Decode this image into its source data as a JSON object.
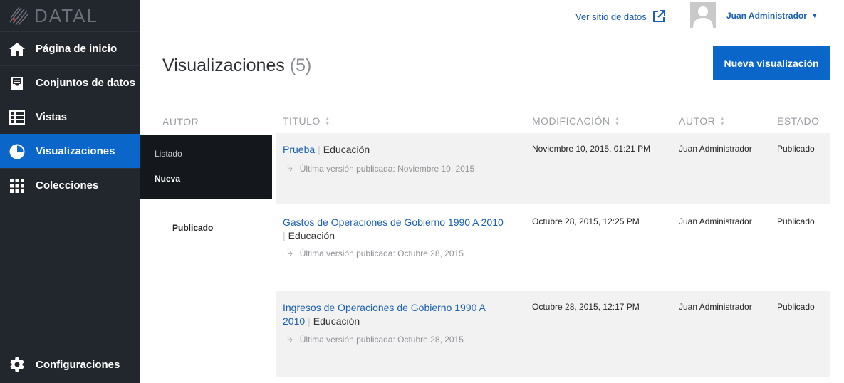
{
  "brand": {
    "name": "DATAL"
  },
  "sidebar": {
    "items": [
      {
        "label": "Página de inicio",
        "icon": "home-icon"
      },
      {
        "label": "Conjuntos de datos",
        "icon": "inbox-icon"
      },
      {
        "label": "Vistas",
        "icon": "table-icon"
      },
      {
        "label": "Visualizaciones",
        "icon": "pie-chart-icon",
        "active": true
      },
      {
        "label": "Colecciones",
        "icon": "grid-icon"
      }
    ],
    "settings": {
      "label": "Configuraciones",
      "icon": "gear-icon"
    },
    "submenu": {
      "listado": "Listado",
      "nueva": "Nueva"
    }
  },
  "header": {
    "external_link": "Ver sitio de datos",
    "user_name": "Juan Administrador",
    "caret": "▼"
  },
  "page": {
    "title": "Visualizaciones",
    "count": "(5)",
    "new_button": "Nueva visualización"
  },
  "filters": {
    "autor_label": "AUTOR",
    "estado_value": "Publicado"
  },
  "table": {
    "headers": {
      "titulo": "TITULO",
      "modificacion": "MODIFICACIÓN",
      "autor": "AUTOR",
      "estado": "ESTADO"
    },
    "rows": [
      {
        "title": "Prueba",
        "category": "Educación",
        "version": "Última versión publicada: Noviembre 10, 2015",
        "modified": "Noviembre 10, 2015, 01:21 PM",
        "author": "Juan Administrador",
        "status": "Publicado"
      },
      {
        "title": "Gastos de Operaciones de Gobierno 1990 A 2010",
        "category": "Educación",
        "version": "Última versión publicada: Octubre 28, 2015",
        "modified": "Octubre 28, 2015, 12:25 PM",
        "author": "Juan Administrador",
        "status": "Publicado"
      },
      {
        "title": "Ingresos de Operaciones de Gobierno  1990 A 2010",
        "category": "Educación",
        "version": "Última versión publicada: Octubre 28, 2015",
        "modified": "Octubre 28, 2015, 12:17 PM",
        "author": "Juan Administrador",
        "status": "Publicado"
      }
    ]
  },
  "colors": {
    "sidebar_bg": "#22262d",
    "accent": "#0a66c9",
    "link": "#1a5fb4",
    "row_bg": "#f2f2f2"
  }
}
